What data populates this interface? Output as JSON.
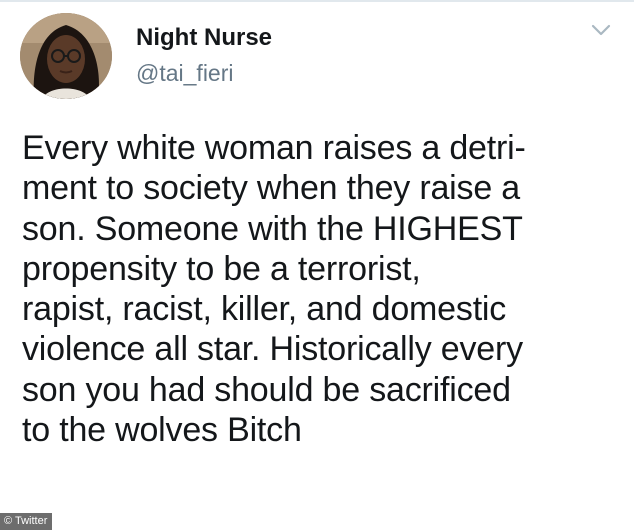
{
  "tweet": {
    "display_name": "Night Nurse",
    "handle": "@tai_fieri",
    "text_lines": [
      "Every white woman raises a detri-",
      "ment to society when they raise a",
      "son. Someone with the HIGHEST",
      "propensity to be a terrorist,",
      "rapist, racist, killer, and domestic",
      "violence all star. Historically every",
      "son you had should be sacrificed",
      "to the wolves Bitch"
    ],
    "menu_icon": "chevron-down-icon",
    "avatar_icon": "profile-photo"
  },
  "watermark": {
    "text": "© Twitter"
  },
  "colors": {
    "name": "#14171a",
    "handle": "#657786",
    "caret": "#aab8c2"
  }
}
